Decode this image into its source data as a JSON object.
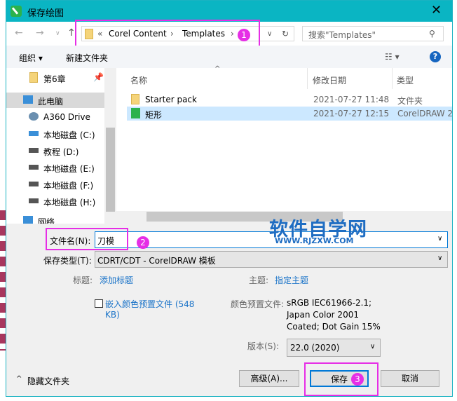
{
  "window": {
    "title": "保存绘图",
    "close": "✕"
  },
  "address": {
    "prefix": "«",
    "crumbs": [
      "Corel Content",
      "Templates"
    ],
    "sep": "›",
    "search_placeholder": "搜索\"Templates\""
  },
  "toolbar": {
    "organize": "组织 ▾",
    "new_folder": "新建文件夹",
    "view": "☷ ▾",
    "help": "?"
  },
  "sidebar": {
    "items": [
      "第6章",
      "此电脑",
      "A360 Drive",
      "本地磁盘 (C:)",
      "教程 (D:)",
      "本地磁盘 (E:)",
      "本地磁盘 (F:)",
      "本地磁盘 (H:)",
      "网络"
    ]
  },
  "columns": {
    "name": "名称",
    "date": "修改日期",
    "type": "类型"
  },
  "files": [
    {
      "name": "Starter pack",
      "date": "2021-07-27 11:48",
      "type": "文件夹"
    },
    {
      "name": "矩形",
      "date": "2021-07-27 12:15",
      "type": "CorelDRAW 2"
    }
  ],
  "form": {
    "filename_label": "文件名(N):",
    "filename": "刀模",
    "type_label": "保存类型(T):",
    "type_value": "CDRT/CDT - CorelDRAW 模板",
    "title_label": "标题:",
    "title_link": "添加标题",
    "subject_label": "主题:",
    "subject_link": "指定主题",
    "embed": "嵌入颜色预置文件 (548",
    "embed2": "KB)",
    "profile_label": "颜色预置文件:",
    "profile": [
      "sRGB IEC61966-2.1;",
      "Japan Color 2001",
      "Coated; Dot Gain 15%"
    ],
    "version_label": "版本(S):",
    "version": "22.0 (2020)"
  },
  "buttons": {
    "hide": "隐藏文件夹",
    "advanced": "高级(A)...",
    "save": "保存",
    "cancel": "取消"
  },
  "badges": [
    "1",
    "2",
    "3"
  ],
  "watermark": {
    "text": "软件自学网",
    "url": "WWW.RJZXW.COM"
  }
}
